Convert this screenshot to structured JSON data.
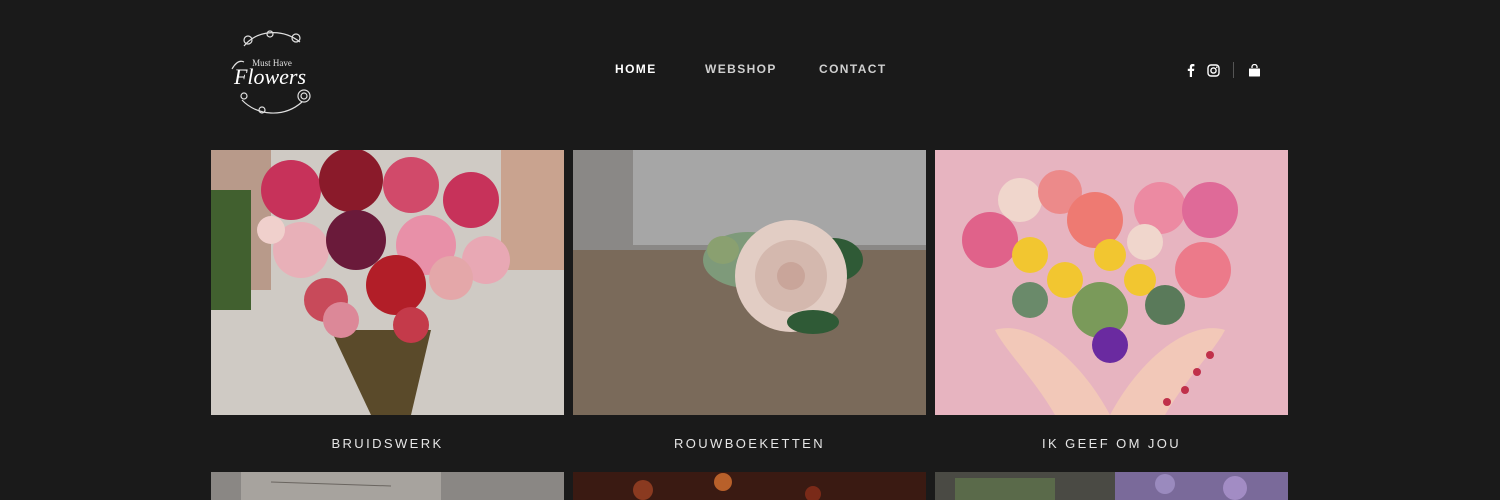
{
  "logo": {
    "text_top": "Must Have",
    "text_main": "Flowers"
  },
  "nav": {
    "items": [
      "HOME",
      "WEBSHOP",
      "CONTACT"
    ]
  },
  "social": [
    "facebook-icon",
    "instagram-icon",
    "shopping-bag-icon"
  ],
  "colors": {
    "background": "#1a1a1a",
    "text": "#e8e8e8",
    "accent_pink": "#e8b5c2"
  },
  "cards": [
    {
      "title": "BRUIDSWERK"
    },
    {
      "title": "ROUWBOEKETTEN"
    },
    {
      "title": "IK GEEF OM JOU"
    }
  ]
}
